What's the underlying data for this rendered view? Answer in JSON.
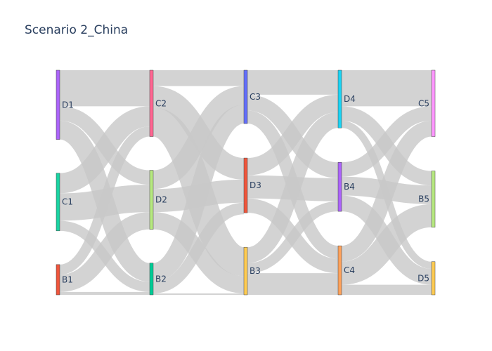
{
  "title": "Scenario 2_China",
  "diagram": {
    "type": "sankey",
    "link_color": "#c8c8c8",
    "columns": [
      {
        "nodes": [
          {
            "id": "D1",
            "label": "D1",
            "color": "#ab63fa",
            "value": 48
          },
          {
            "id": "C1",
            "label": "C1",
            "color": "#19d3a2",
            "value": 40
          },
          {
            "id": "B1",
            "label": "B1",
            "color": "#ef553b",
            "value": 21
          }
        ]
      },
      {
        "nodes": [
          {
            "id": "C2",
            "label": "C2",
            "color": "#ff6692",
            "value": 46
          },
          {
            "id": "D2",
            "label": "D2",
            "color": "#b6e880",
            "value": 41
          },
          {
            "id": "B2",
            "label": "B2",
            "color": "#00cc96",
            "value": 22
          }
        ]
      },
      {
        "nodes": [
          {
            "id": "C3",
            "label": "C3",
            "color": "#636efa",
            "value": 37
          },
          {
            "id": "D3",
            "label": "D3",
            "color": "#ef553b",
            "value": 38
          },
          {
            "id": "B3",
            "label": "B3",
            "color": "#fecb52",
            "value": 33
          }
        ]
      },
      {
        "nodes": [
          {
            "id": "D4",
            "label": "D4",
            "color": "#19d3f3",
            "value": 40
          },
          {
            "id": "B4",
            "label": "B4",
            "color": "#ab63fa",
            "value": 34
          },
          {
            "id": "C4",
            "label": "C4",
            "color": "#ffa15a",
            "value": 34
          }
        ]
      },
      {
        "nodes": [
          {
            "id": "C5",
            "label": "C5",
            "color": "#ff97ff",
            "value": 46
          },
          {
            "id": "B5",
            "label": "B5",
            "color": "#b6e880",
            "value": 39
          },
          {
            "id": "D5",
            "label": "D5",
            "color": "#fecb52",
            "value": 23
          }
        ]
      }
    ],
    "links": [
      {
        "source": "D1",
        "target": "C2",
        "value": 25
      },
      {
        "source": "D1",
        "target": "D2",
        "value": 10
      },
      {
        "source": "D1",
        "target": "B2",
        "value": 13
      },
      {
        "source": "C1",
        "target": "C2",
        "value": 14
      },
      {
        "source": "C1",
        "target": "D2",
        "value": 19
      },
      {
        "source": "C1",
        "target": "B2",
        "value": 7
      },
      {
        "source": "B1",
        "target": "C2",
        "value": 7
      },
      {
        "source": "B1",
        "target": "D2",
        "value": 12
      },
      {
        "source": "B1",
        "target": "B2",
        "value": 2
      },
      {
        "source": "C2",
        "target": "C3",
        "value": 11
      },
      {
        "source": "C2",
        "target": "D3",
        "value": 15
      },
      {
        "source": "C2",
        "target": "B3",
        "value": 20
      },
      {
        "source": "D2",
        "target": "C3",
        "value": 13
      },
      {
        "source": "D2",
        "target": "D3",
        "value": 16
      },
      {
        "source": "D2",
        "target": "B3",
        "value": 12
      },
      {
        "source": "B2",
        "target": "C3",
        "value": 13
      },
      {
        "source": "B2",
        "target": "D3",
        "value": 8
      },
      {
        "source": "B2",
        "target": "B3",
        "value": 1
      },
      {
        "source": "C3",
        "target": "D4",
        "value": 17
      },
      {
        "source": "C3",
        "target": "B4",
        "value": 11
      },
      {
        "source": "C3",
        "target": "C4",
        "value": 9
      },
      {
        "source": "D3",
        "target": "D4",
        "value": 12
      },
      {
        "source": "D3",
        "target": "B4",
        "value": 16
      },
      {
        "source": "D3",
        "target": "C4",
        "value": 10
      },
      {
        "source": "B3",
        "target": "D4",
        "value": 11
      },
      {
        "source": "B3",
        "target": "B4",
        "value": 7
      },
      {
        "source": "B3",
        "target": "C4",
        "value": 15
      },
      {
        "source": "D4",
        "target": "C5",
        "value": 25
      },
      {
        "source": "D4",
        "target": "B5",
        "value": 10
      },
      {
        "source": "D4",
        "target": "D5",
        "value": 5
      },
      {
        "source": "B4",
        "target": "C5",
        "value": 10
      },
      {
        "source": "B4",
        "target": "B5",
        "value": 13
      },
      {
        "source": "B4",
        "target": "D5",
        "value": 11
      },
      {
        "source": "C4",
        "target": "C5",
        "value": 11
      },
      {
        "source": "C4",
        "target": "B5",
        "value": 16
      },
      {
        "source": "C4",
        "target": "D5",
        "value": 7
      }
    ]
  }
}
